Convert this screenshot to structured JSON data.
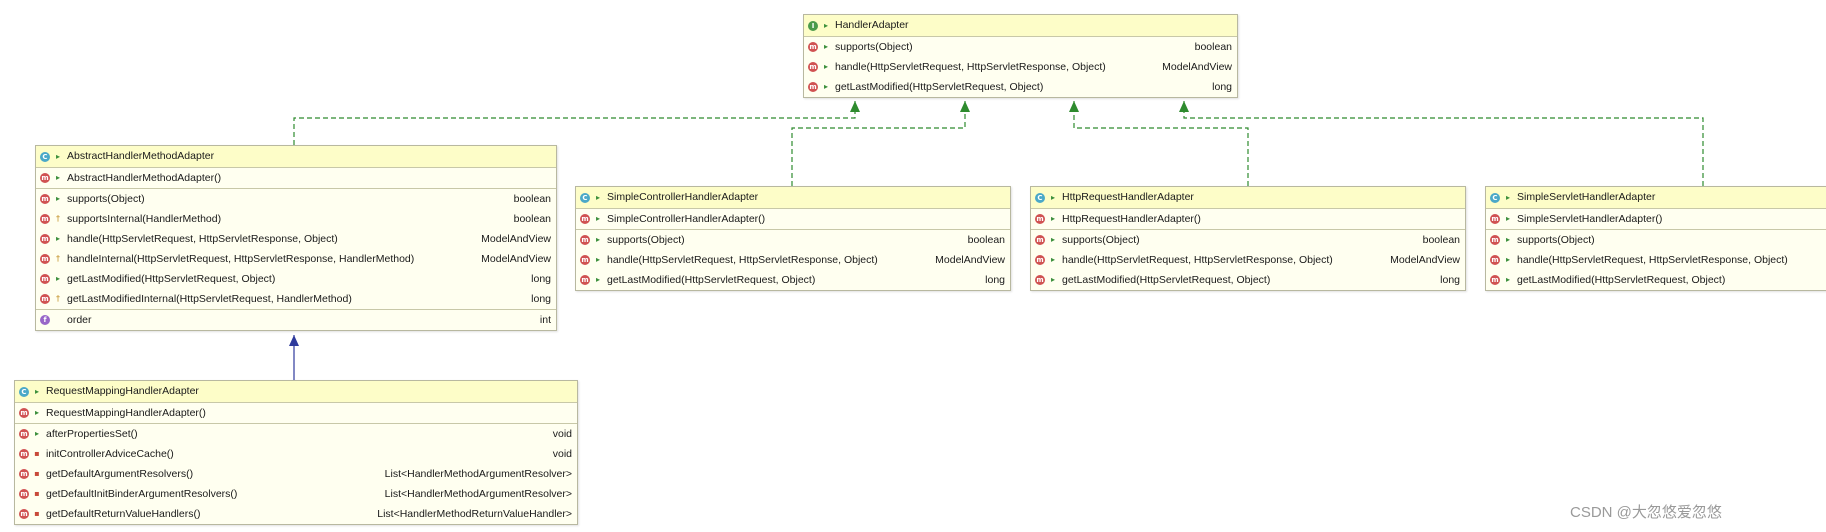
{
  "classes": [
    {
      "name": "HandlerAdapter",
      "kind": "I",
      "sections": [
        [
          {
            "kind": "m",
            "vis": "pub",
            "sig": "supports(Object)",
            "ret": "boolean"
          },
          {
            "kind": "m",
            "vis": "pub",
            "sig": "handle(HttpServletRequest, HttpServletResponse, Object)",
            "ret": "ModelAndView"
          },
          {
            "kind": "m",
            "vis": "pub",
            "sig": "getLastModified(HttpServletRequest, Object)",
            "ret": "long"
          }
        ]
      ]
    },
    {
      "name": "AbstractHandlerMethodAdapter",
      "kind": "C",
      "sections": [
        [
          {
            "kind": "m",
            "vis": "pub",
            "sig": "AbstractHandlerMethodAdapter()",
            "ret": ""
          }
        ],
        [
          {
            "kind": "m",
            "vis": "pub",
            "sig": "supports(Object)",
            "ret": "boolean"
          },
          {
            "kind": "m",
            "vis": "prot",
            "sig": "supportsInternal(HandlerMethod)",
            "ret": "boolean"
          },
          {
            "kind": "m",
            "vis": "pub",
            "sig": "handle(HttpServletRequest, HttpServletResponse, Object)",
            "ret": "ModelAndView"
          },
          {
            "kind": "m",
            "vis": "prot",
            "sig": "handleInternal(HttpServletRequest, HttpServletResponse, HandlerMethod)",
            "ret": "ModelAndView"
          },
          {
            "kind": "m",
            "vis": "pub",
            "sig": "getLastModified(HttpServletRequest, Object)",
            "ret": "long"
          },
          {
            "kind": "m",
            "vis": "prot",
            "sig": "getLastModifiedInternal(HttpServletRequest, HandlerMethod)",
            "ret": "long"
          }
        ],
        [
          {
            "kind": "f",
            "vis": "none",
            "sig": "order",
            "ret": "int"
          }
        ]
      ]
    },
    {
      "name": "SimpleControllerHandlerAdapter",
      "kind": "C",
      "sections": [
        [
          {
            "kind": "m",
            "vis": "pub",
            "sig": "SimpleControllerHandlerAdapter()",
            "ret": ""
          }
        ],
        [
          {
            "kind": "m",
            "vis": "pub",
            "sig": "supports(Object)",
            "ret": "boolean"
          },
          {
            "kind": "m",
            "vis": "pub",
            "sig": "handle(HttpServletRequest, HttpServletResponse, Object)",
            "ret": "ModelAndView"
          },
          {
            "kind": "m",
            "vis": "pub",
            "sig": "getLastModified(HttpServletRequest, Object)",
            "ret": "long"
          }
        ]
      ]
    },
    {
      "name": "HttpRequestHandlerAdapter",
      "kind": "C",
      "sections": [
        [
          {
            "kind": "m",
            "vis": "pub",
            "sig": "HttpRequestHandlerAdapter()",
            "ret": ""
          }
        ],
        [
          {
            "kind": "m",
            "vis": "pub",
            "sig": "supports(Object)",
            "ret": "boolean"
          },
          {
            "kind": "m",
            "vis": "pub",
            "sig": "handle(HttpServletRequest, HttpServletResponse, Object)",
            "ret": "ModelAndView"
          },
          {
            "kind": "m",
            "vis": "pub",
            "sig": "getLastModified(HttpServletRequest, Object)",
            "ret": "long"
          }
        ]
      ]
    },
    {
      "name": "SimpleServletHandlerAdapter",
      "kind": "C",
      "sections": [
        [
          {
            "kind": "m",
            "vis": "pub",
            "sig": "SimpleServletHandlerAdapter()",
            "ret": ""
          }
        ],
        [
          {
            "kind": "m",
            "vis": "pub",
            "sig": "supports(Object)",
            "ret": ""
          },
          {
            "kind": "m",
            "vis": "pub",
            "sig": "handle(HttpServletRequest, HttpServletResponse, Object)",
            "ret": ""
          },
          {
            "kind": "m",
            "vis": "pub",
            "sig": "getLastModified(HttpServletRequest, Object)",
            "ret": ""
          }
        ]
      ]
    },
    {
      "name": "RequestMappingHandlerAdapter",
      "kind": "C",
      "sections": [
        [
          {
            "kind": "m",
            "vis": "pub",
            "sig": "RequestMappingHandlerAdapter()",
            "ret": ""
          }
        ],
        [
          {
            "kind": "m",
            "vis": "pub",
            "sig": "afterPropertiesSet()",
            "ret": "void"
          },
          {
            "kind": "m",
            "vis": "priv",
            "sig": "initControllerAdviceCache()",
            "ret": "void"
          },
          {
            "kind": "m",
            "vis": "priv",
            "sig": "getDefaultArgumentResolvers()",
            "ret": "List<HandlerMethodArgumentResolver>"
          },
          {
            "kind": "m",
            "vis": "priv",
            "sig": "getDefaultInitBinderArgumentResolvers()",
            "ret": "List<HandlerMethodArgumentResolver>"
          },
          {
            "kind": "m",
            "vis": "priv",
            "sig": "getDefaultReturnValueHandlers()",
            "ret": "List<HandlerMethodReturnValueHandler>"
          }
        ]
      ]
    }
  ],
  "relations": [
    {
      "from": "AbstractHandlerMethodAdapter",
      "to": "HandlerAdapter",
      "type": "realization"
    },
    {
      "from": "SimpleControllerHandlerAdapter",
      "to": "HandlerAdapter",
      "type": "realization"
    },
    {
      "from": "HttpRequestHandlerAdapter",
      "to": "HandlerAdapter",
      "type": "realization"
    },
    {
      "from": "SimpleServletHandlerAdapter",
      "to": "HandlerAdapter",
      "type": "realization"
    },
    {
      "from": "RequestMappingHandlerAdapter",
      "to": "AbstractHandlerMethodAdapter",
      "type": "inheritance"
    }
  ],
  "colors": {
    "realization": "#2e8b2e",
    "inheritance": "#2e3a9c",
    "box_bg": "#fffff0",
    "title_bg": "#fdfdc8"
  },
  "watermark": "CSDN @大忽悠爱忽悠"
}
